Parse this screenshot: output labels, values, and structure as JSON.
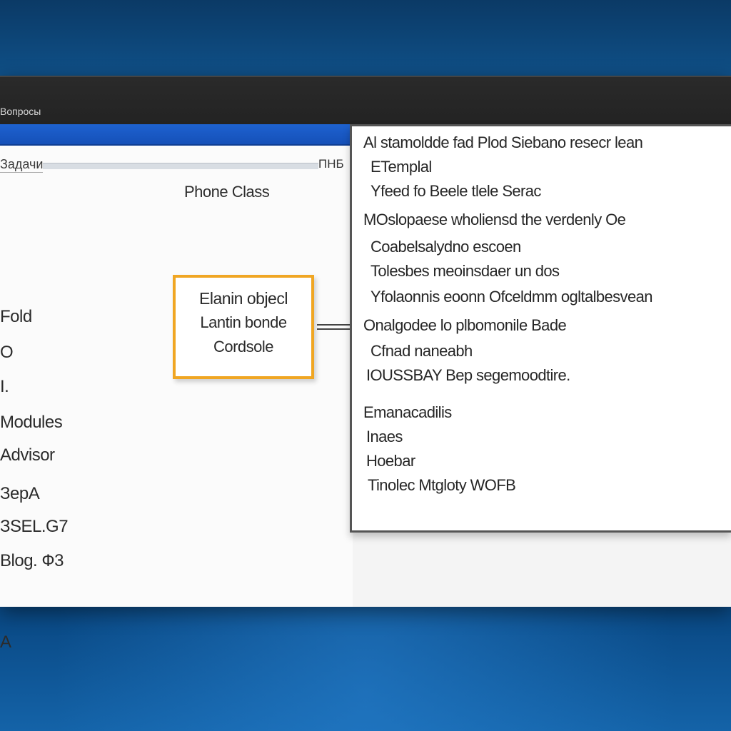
{
  "window": {
    "title": "Вопросы"
  },
  "main": {
    "search_label": "Задачи",
    "search_mark": "ПНБ",
    "section_heading": "Phone Class",
    "left_items": [
      "Fold",
      "O",
      "I.",
      "Modules",
      "Advisor",
      "ЗерА",
      "ЗSEL.G7",
      "Blog. Ф3",
      "А"
    ]
  },
  "callout": {
    "lines": [
      "Elanin objecl",
      "Lantin bonde",
      "Cordsole"
    ]
  },
  "detail": {
    "rows": [
      "Al stamoldde fad Plod Siebano resecr lean",
      "ETemplal",
      "Yfeed fo Beele tlele Serac",
      "MOslopaese wholiensd the verdenly Oe",
      "Coabelsalydno escoen",
      "Tolesbes meoinsdaer un dos",
      "Yfolaonnis eoonn Ofceldmm ogltalbesvean",
      "Onalgodee lo plbomonile Bade",
      "Cfnad naneabh",
      "IOUSSBAY Bep segemoodtire.",
      "Emanacadilis",
      "Inaes",
      "Hoebar",
      "Tinolec Mtgloty WOFB"
    ]
  },
  "colors": {
    "desktop": "#0b3f6e",
    "titlebar": "#262626",
    "accent_blue": "#1e62d0",
    "callout_border": "#f0a623"
  }
}
